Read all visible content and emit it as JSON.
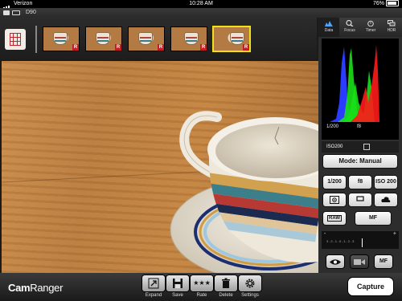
{
  "status_bar": {
    "carrier": "Verizon",
    "time": "10:28 AM",
    "battery": "76%"
  },
  "camera_bar": {
    "camera_name": "D90"
  },
  "thumbnails": [
    {
      "badge": "R",
      "selected": false
    },
    {
      "badge": "R",
      "selected": false
    },
    {
      "badge": "R",
      "selected": false
    },
    {
      "badge": "R",
      "selected": false
    },
    {
      "badge": "R",
      "selected": true
    }
  ],
  "panel_tabs": [
    {
      "label": "Data",
      "icon": "histogram-icon",
      "active": true
    },
    {
      "label": "Focus",
      "icon": "magnifier-icon",
      "active": false
    },
    {
      "label": "Timer",
      "icon": "stopwatch-icon",
      "active": false
    },
    {
      "label": "HDR",
      "icon": "hdr-stack-icon",
      "active": false
    }
  ],
  "histogram": {
    "shutter": "1/200",
    "aperture": "f8",
    "iso": "ISO200",
    "colors": {
      "red": "#ff1a1a",
      "green": "#18e018",
      "blue": "#2a3cff"
    }
  },
  "controls": {
    "mode": "Mode: Manual",
    "shutter": "1/200",
    "aperture": "f8",
    "iso": "ISO 200",
    "raw": "RAW",
    "focus_mode": "MF",
    "ev_scale": "3..2..1..0..1..2..3",
    "ev_minus": "-",
    "ev_plus": "+",
    "mf_button": "MF"
  },
  "toolbar": {
    "logo_cam": "Cam",
    "logo_ranger": "Ranger",
    "expand": "Expand",
    "save": "Save",
    "rate": "Rate",
    "delete": "Delete",
    "settings": "Settings",
    "rate_stars": "★★★",
    "capture": "Capture"
  }
}
